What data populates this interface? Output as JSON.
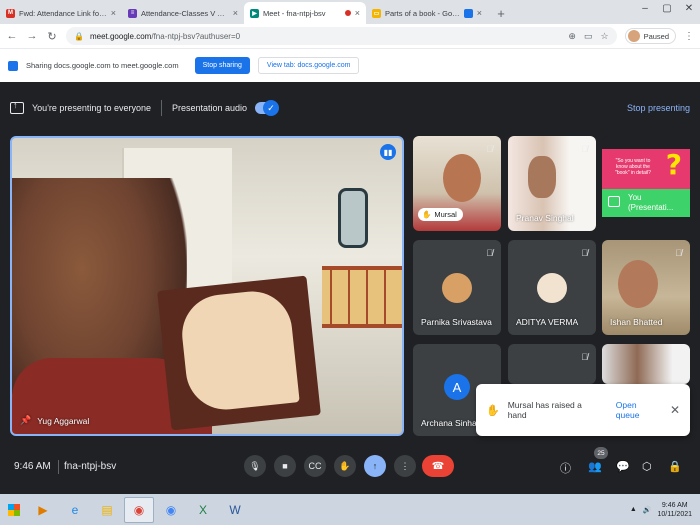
{
  "browser": {
    "tabs": [
      {
        "title": "Fwd: Attendance Link for III - IV",
        "favicon": "gmail-icon",
        "color": "#d93025",
        "glyph": "M"
      },
      {
        "title": "Attendance-Classes V TO VIII",
        "favicon": "forms-icon",
        "color": "#673ab7",
        "glyph": "≡"
      },
      {
        "title": "Meet - fna-ntpj-bsv",
        "favicon": "meet-icon",
        "color": "#00897b",
        "glyph": "▶"
      },
      {
        "title": "Parts of a book - Google Slid",
        "favicon": "slides-icon",
        "color": "#f4b400",
        "glyph": "▭"
      }
    ],
    "url_host": "meet.google.com",
    "url_path": "/fna-ntpj-bsv?authuser=0",
    "profile_label": "Paused"
  },
  "share_bar": {
    "text": "Sharing docs.google.com to meet.google.com",
    "stop_label": "Stop sharing",
    "view_label": "View tab: docs.google.com"
  },
  "presentation_bar": {
    "status": "You're presenting to everyone",
    "audio_label": "Presentation audio",
    "stop_label": "Stop presenting"
  },
  "main_stage": {
    "name": "Yug Aggarwal"
  },
  "participants": [
    {
      "name": "Mursal"
    },
    {
      "name": "Pranav Singhal"
    },
    {
      "name": "You (Presentation)",
      "line1": "You",
      "line2": "(Presentati..."
    },
    {
      "name": "Parnika Srivastava"
    },
    {
      "name": "ADITYA VERMA"
    },
    {
      "name": "Ishan Bhatted"
    },
    {
      "name": "Archana Sinha",
      "initial": "A"
    }
  ],
  "slide_preview_text": "\"So you want to know about the \"book\" in detail?",
  "notification": {
    "message": "Mursal has raised a hand",
    "action": "Open queue"
  },
  "meeting": {
    "time": "9:46 AM",
    "code": "fna-ntpj-bsv",
    "people_count": "25"
  },
  "taskbar": {
    "time": "9:46 AM",
    "date": "10/11/2021"
  },
  "colors": {
    "accent": "#1a73e8",
    "leave": "#ea4335",
    "meet_bg": "#202124",
    "highlight": "#8ab4f8"
  }
}
